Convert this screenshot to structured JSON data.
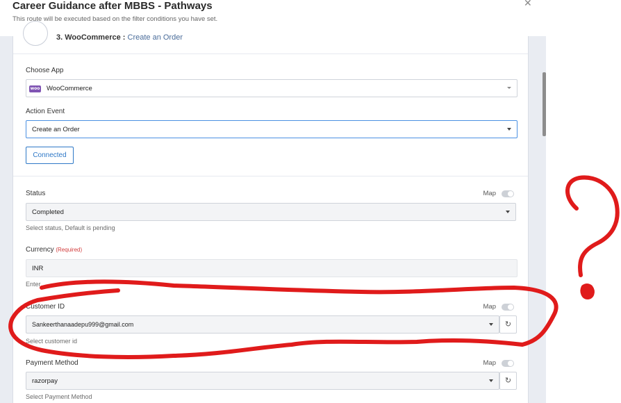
{
  "modal": {
    "title": "Career Guidance after MBBS - Pathways",
    "subtitle": "This route will be executed based on the filter conditions you have set.",
    "close_icon": "close-icon"
  },
  "step": {
    "number_title": "3. WooCommerce :",
    "action": "Create an Order"
  },
  "choose_app": {
    "label": "Choose App",
    "value": "WooCommerce",
    "logo_text": "woo"
  },
  "action_event": {
    "label": "Action Event",
    "value": "Create an Order"
  },
  "connected_label": "Connected",
  "fields": {
    "status": {
      "label": "Status",
      "map_label": "Map",
      "value": "Completed",
      "help": "Select status, Default is pending"
    },
    "currency": {
      "label": "Currency",
      "required": "(Required)",
      "value": "INR",
      "help": "Enter"
    },
    "customer_id": {
      "label": "Customer ID",
      "map_label": "Map",
      "value": "Sankeerthanaadepu999@gmail.com",
      "help": "Select customer id"
    },
    "payment_method": {
      "label": "Payment Method",
      "map_label": "Map",
      "value": "razorpay",
      "help": "Select Payment Method"
    }
  },
  "colors": {
    "accent": "#2e78c7",
    "annotation": "#e01b1b",
    "woo_purple": "#7f54b3"
  }
}
